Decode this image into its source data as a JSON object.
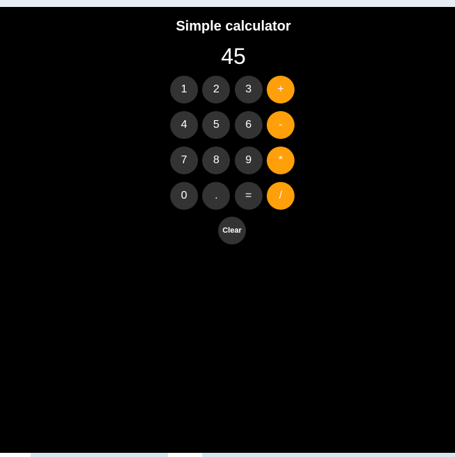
{
  "app": {
    "title": "Simple calculator",
    "display_value": "45"
  },
  "keys": [
    {
      "label": "1",
      "kind": "number"
    },
    {
      "label": "2",
      "kind": "number"
    },
    {
      "label": "3",
      "kind": "number"
    },
    {
      "label": "+",
      "kind": "operator"
    },
    {
      "label": "4",
      "kind": "number"
    },
    {
      "label": "5",
      "kind": "number"
    },
    {
      "label": "6",
      "kind": "number"
    },
    {
      "label": "-",
      "kind": "operator"
    },
    {
      "label": "7",
      "kind": "number"
    },
    {
      "label": "8",
      "kind": "number"
    },
    {
      "label": "9",
      "kind": "number"
    },
    {
      "label": "*",
      "kind": "operator"
    },
    {
      "label": "0",
      "kind": "number"
    },
    {
      "label": ".",
      "kind": "number"
    },
    {
      "label": "=",
      "kind": "number"
    },
    {
      "label": "/",
      "kind": "operator"
    }
  ],
  "clear_label": "Clear",
  "colors": {
    "background": "#000000",
    "number_key": "#333333",
    "operator_key": "#ff9f0a",
    "text": "#ffffff"
  }
}
